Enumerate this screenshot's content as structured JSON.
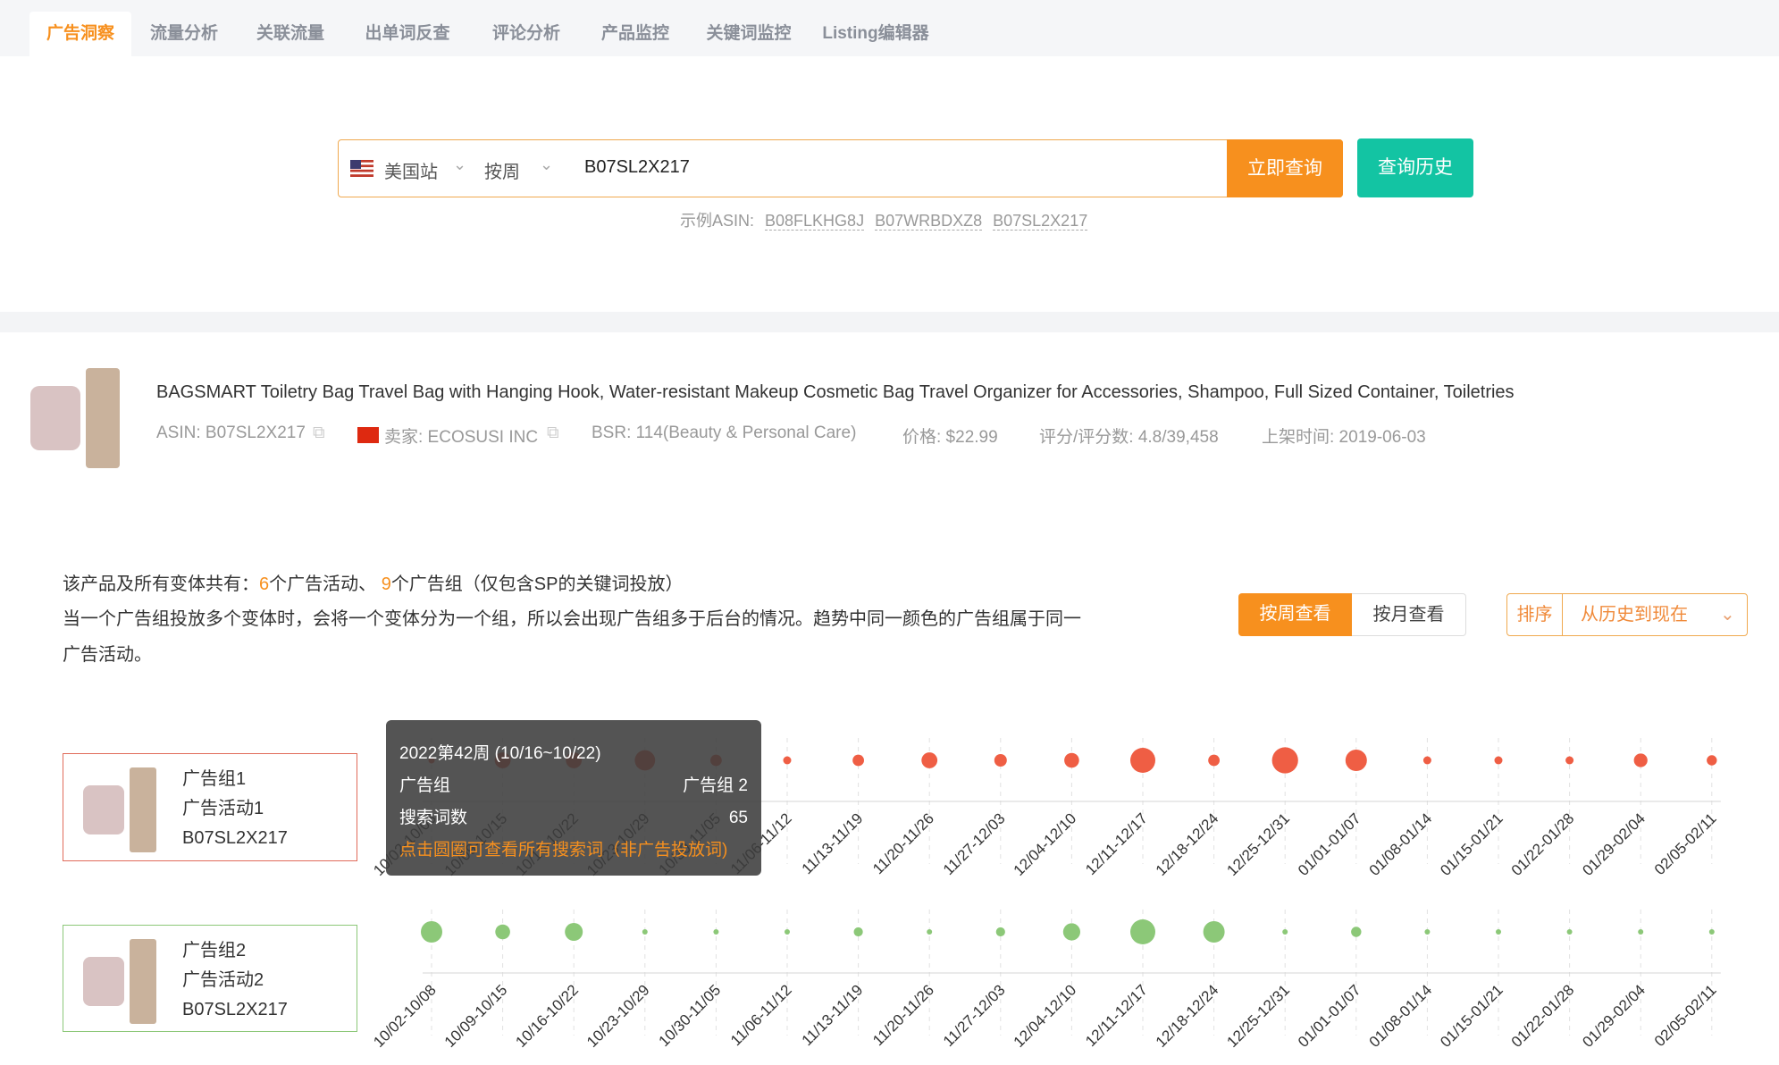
{
  "tabs": [
    "广告洞察",
    "流量分析",
    "关联流量",
    "出单词反查",
    "评论分析",
    "产品监控",
    "关键词监控",
    "Listing编辑器"
  ],
  "search": {
    "site": "美国站",
    "period": "按周",
    "value": "B07SL2X217",
    "go": "立即查询",
    "history": "查询历史",
    "example_label": "示例ASIN:",
    "examples": [
      "B08FLKHG8J",
      "B07WRBDXZ8",
      "B07SL2X217"
    ]
  },
  "product": {
    "title": "BAGSMART Toiletry Bag Travel Bag with Hanging Hook, Water-resistant Makeup Cosmetic Bag Travel Organizer for Accessories, Shampoo, Full Sized Container, Toiletries",
    "asin": "ASIN: B07SL2X217",
    "seller": "卖家: ECOSUSI INC",
    "bsr": "BSR: 114(Beauty & Personal Care)",
    "price": "价格: $22.99",
    "rating": "评分/评分数: 4.8/39,458",
    "listed": "上架时间: 2019-06-03"
  },
  "summary": {
    "p1": "该产品及所有变体共有：",
    "campaigns": "6",
    "p2": "个广告活动、 ",
    "groups": "9",
    "p3": "个广告组（仅包含SP的关键词投放）",
    "line2": "当一个广告组投放多个变体时，会将一个变体分为一个组，所以会出现广告组多于后台的情况。趋势中同一颜色的广告组属于同一",
    "line3": "广告活动。"
  },
  "controls": {
    "weekly": "按周查看",
    "monthly": "按月查看",
    "sort_label": "排序",
    "sort_value": "从历史到现在"
  },
  "colors": {
    "accent": "#f7901e",
    "teal": "#13c4a3",
    "red": "#ef5e44",
    "green": "#8cc878"
  },
  "groups": [
    {
      "name": "广告组1",
      "campaign": "广告活动1",
      "asin": "B07SL2X217"
    },
    {
      "name": "广告组2",
      "campaign": "广告活动2",
      "asin": "B07SL2X217"
    }
  ],
  "tooltip": {
    "title": "2022第42周 (10/16~10/22)",
    "k1": "广告组",
    "v1": "广告组 2",
    "k2": "搜索词数",
    "v2": "65",
    "hint": "点击圆圈可查看所有搜索词（非广告投放词)"
  },
  "chart_data": {
    "type": "scatter",
    "categories": [
      "10/02-10/08",
      "10/09-10/15",
      "10/16-10/22",
      "10/23-10/29",
      "10/30-11/05",
      "11/06-11/12",
      "11/13-11/19",
      "11/20-11/26",
      "11/27-12/03",
      "12/04-12/10",
      "12/11-12/17",
      "12/18-12/24",
      "12/25-12/31",
      "01/01-01/07",
      "01/08-01/14",
      "01/15-01/21",
      "01/22-01/28",
      "01/29-02/04",
      "02/05-02/11"
    ],
    "series": [
      {
        "name": "广告组1",
        "values": [
          8,
          52,
          52,
          85,
          27,
          13,
          27,
          52,
          32,
          45,
          127,
          27,
          139,
          94,
          13,
          13,
          13,
          38,
          21
        ]
      },
      {
        "name": "广告组2",
        "values": [
          94,
          45,
          65,
          6,
          6,
          6,
          17,
          6,
          17,
          60,
          127,
          94,
          6,
          21,
          6,
          6,
          6,
          6,
          6
        ]
      }
    ]
  }
}
